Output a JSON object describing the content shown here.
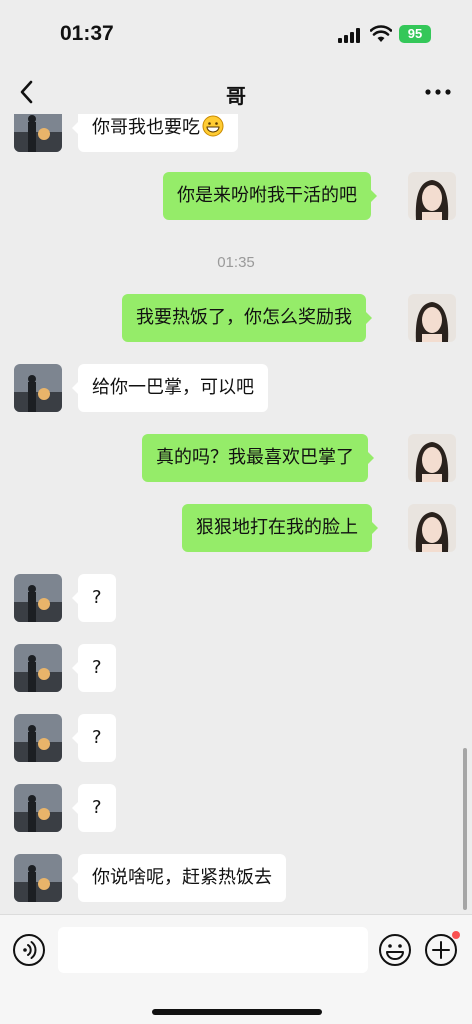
{
  "status_bar": {
    "time": "01:37",
    "battery": "95"
  },
  "nav": {
    "title": "哥"
  },
  "messages": [
    {
      "side": "left",
      "text": "你哥我也要吃",
      "emoji": "grinning-face"
    },
    {
      "side": "right",
      "text": "你是来吩咐我干活的吧"
    },
    {
      "type": "time",
      "text": "01:35"
    },
    {
      "side": "right",
      "text": "我要热饭了，你怎么奖励我"
    },
    {
      "side": "left",
      "text": "给你一巴掌，可以吧"
    },
    {
      "side": "right",
      "text": "真的吗？我最喜欢巴掌了"
    },
    {
      "side": "right",
      "text": "狠狠地打在我的脸上"
    },
    {
      "side": "left",
      "text": "?"
    },
    {
      "side": "left",
      "text": "?"
    },
    {
      "side": "left",
      "text": "?"
    },
    {
      "side": "left",
      "text": "?"
    },
    {
      "side": "left",
      "text": "你说啥呢，赶紧热饭去"
    }
  ],
  "icons": {
    "back": "chevron-left-icon",
    "more": "more-dots-icon",
    "voice": "voice-icon",
    "emoji": "emoji-icon",
    "plus": "plus-icon"
  },
  "colors": {
    "sent_bubble": "#95ec69",
    "received_bubble": "#ffffff",
    "background": "#ededed"
  }
}
